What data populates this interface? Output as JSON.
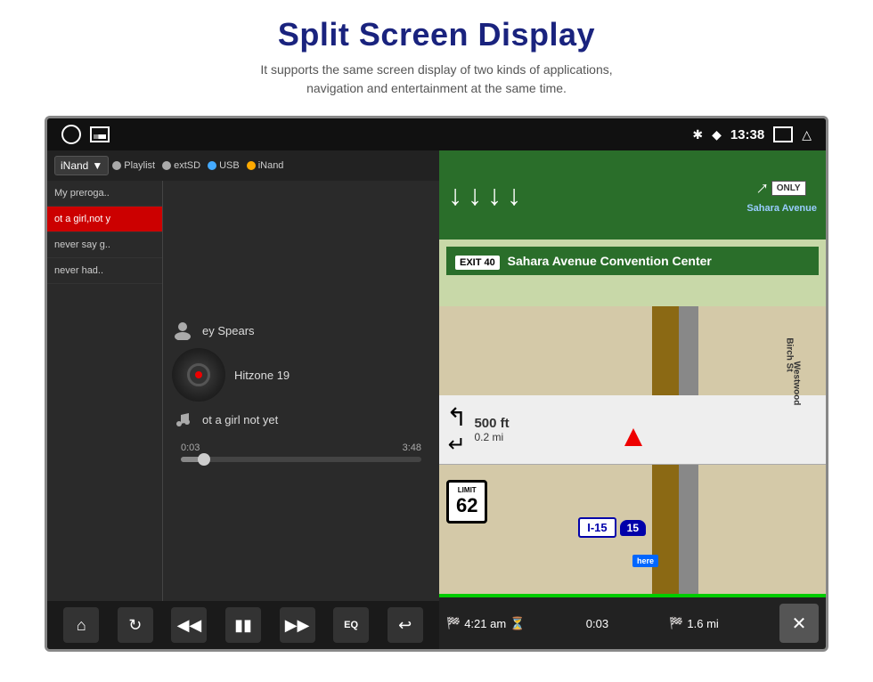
{
  "header": {
    "title": "Split Screen Display",
    "subtitle": "It supports the same screen display of two kinds of applications,\nnavigation and entertainment at the same time."
  },
  "status_bar": {
    "time": "13:38",
    "bluetooth_icon": "bluetooth",
    "location_icon": "location-pin",
    "window_icon": "window",
    "back_icon": "back-arrow"
  },
  "music_panel": {
    "source_dropdown": "iNand",
    "sources": [
      "Playlist",
      "extSD",
      "USB",
      "iNand"
    ],
    "playlist": [
      {
        "label": "My preroga..",
        "active": false
      },
      {
        "label": "ot a girl,not y",
        "active": true
      },
      {
        "label": "never say g..",
        "active": false
      },
      {
        "label": "never had..",
        "active": false
      }
    ],
    "artist": "ey Spears",
    "album": "Hitzone 19",
    "song": "ot a girl not yet",
    "time_current": "0:03",
    "time_total": "3:48",
    "progress_percent": 8,
    "controls": [
      "home",
      "repeat",
      "prev",
      "pause",
      "next",
      "EQ",
      "back"
    ]
  },
  "nav_panel": {
    "highway": "I-15",
    "exit_number": "EXIT 40",
    "destination": "Sahara Avenue Convention Center",
    "speed": "62",
    "interstate": "I-15",
    "interstate_num": "15",
    "distance_turn": "500 ft",
    "distance_road": "0.2 mi",
    "eta_time": "4:21 am",
    "eta_duration": "0:03",
    "eta_distance": "1.6 mi",
    "street1": "Birch St",
    "street2": "Westwood",
    "sahara": "Sahara Avenue",
    "only_label": "ONLY"
  }
}
